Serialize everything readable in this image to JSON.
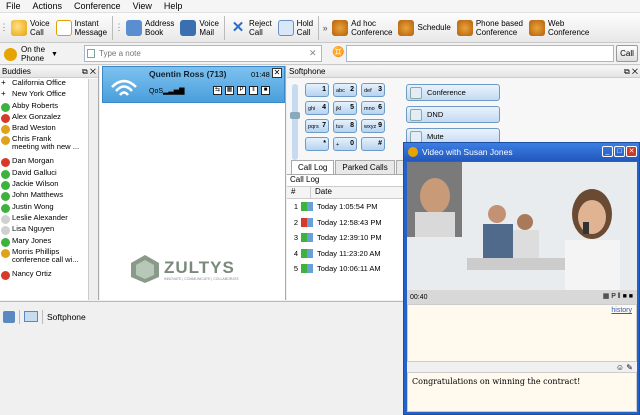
{
  "menu": [
    "File",
    "Actions",
    "Conference",
    "View",
    "Help"
  ],
  "toolbar": {
    "voice_call": "Voice\nCall",
    "instant_message": "Instant\nMessage",
    "address_book": "Address\nBook",
    "voice_mail": "Voice\nMail",
    "reject_call": "Reject\nCall",
    "hold_call": "Hold\nCall",
    "adhoc_conference": "Ad hoc\nConference",
    "schedule": "Schedule",
    "phone_conference": "Phone based\nConference",
    "web_conference": "Web\nConference"
  },
  "presence": {
    "status": "On the\nPhone"
  },
  "note": {
    "placeholder": "Type a note"
  },
  "call_button": "Call",
  "buddies": {
    "title": "Buddies",
    "items": [
      {
        "name": "California Office",
        "status": "group"
      },
      {
        "name": "New York Office",
        "status": "group"
      },
      {
        "name": "Abby Roberts",
        "status": "available"
      },
      {
        "name": "Alex Gonzalez",
        "status": "busy"
      },
      {
        "name": "Brad Weston",
        "status": "phone"
      },
      {
        "name": "Chris Frank\nmeeting with new ...",
        "status": "phone"
      },
      {
        "name": "Dan Morgan",
        "status": "busy"
      },
      {
        "name": "David Galluci",
        "status": "available"
      },
      {
        "name": "Jackie Wilson",
        "status": "available"
      },
      {
        "name": "John Matthews",
        "status": "available"
      },
      {
        "name": "Justin Wong",
        "status": "available"
      },
      {
        "name": "Leslie Alexander",
        "status": "offline"
      },
      {
        "name": "Lisa Nguyen",
        "status": "offline"
      },
      {
        "name": "Mary Jones",
        "status": "available"
      },
      {
        "name": "Morris Phillips\nconference call wi...",
        "status": "phone"
      },
      {
        "name": "Nancy Ortiz",
        "status": "busy"
      }
    ]
  },
  "callcard": {
    "name": "Quentin Ross",
    "ext": "(713)",
    "time": "01:48",
    "qos": "QoS"
  },
  "brand": {
    "name": "ZULTYS",
    "tagline": "INNOVATE | COMMUNICATE | COLLABORATE"
  },
  "softphone": {
    "title": "Softphone",
    "keys": [
      {
        "num": "1",
        "letters": ""
      },
      {
        "num": "2",
        "letters": "abc"
      },
      {
        "num": "3",
        "letters": "def"
      },
      {
        "num": "4",
        "letters": "ghi"
      },
      {
        "num": "5",
        "letters": "jkl"
      },
      {
        "num": "6",
        "letters": "mno"
      },
      {
        "num": "7",
        "letters": "pqrs"
      },
      {
        "num": "8",
        "letters": "tuv"
      },
      {
        "num": "9",
        "letters": "wxyz"
      },
      {
        "num": "*",
        "letters": ""
      },
      {
        "num": "0",
        "letters": "+"
      },
      {
        "num": "#",
        "letters": ""
      }
    ],
    "buttons": [
      "Conference",
      "DND",
      "Mute"
    ],
    "tabs": [
      "Call Log",
      "Parked Calls",
      "Vo"
    ]
  },
  "calllog": {
    "title": "Call Log",
    "columns": [
      "#",
      "Date"
    ],
    "rows": [
      {
        "n": "1",
        "date": "Today 1:05:54 PM",
        "kind": "in"
      },
      {
        "n": "2",
        "date": "Today 12:58:43 PM",
        "kind": "missed"
      },
      {
        "n": "3",
        "date": "Today 12:39:10 PM",
        "kind": "in"
      },
      {
        "n": "4",
        "date": "Today 11:23:20 AM",
        "kind": "in"
      },
      {
        "n": "5",
        "date": "Today 10:06:11 AM",
        "kind": "in"
      }
    ]
  },
  "statusbar": {
    "label": "Softphone"
  },
  "video": {
    "title": "Video with Susan Jones",
    "elapsed": "00:40",
    "history_link": "history",
    "compose_text": "Congratulations on winning the contract!"
  },
  "colors": {
    "available": "#3db33d",
    "busy": "#d83a2a",
    "phone": "#e0a21a",
    "offline": "#d0d0d0",
    "group": "#3a7fc9"
  }
}
